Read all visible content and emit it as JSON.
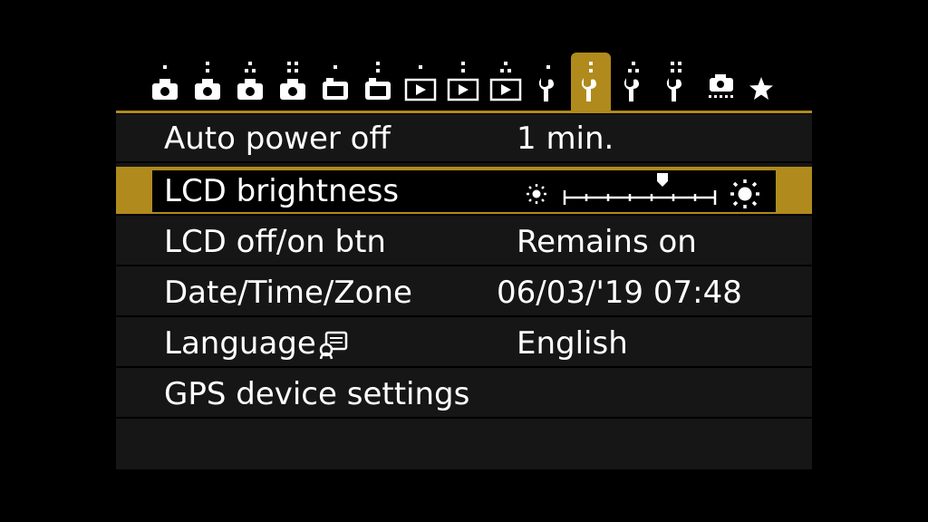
{
  "tabs": [
    {
      "icon": "camera-shooting-1-icon",
      "dots": 1
    },
    {
      "icon": "camera-shooting-2-icon",
      "dots": 2
    },
    {
      "icon": "camera-shooting-3-icon",
      "dots": 3
    },
    {
      "icon": "camera-shooting-4-icon",
      "dots": 4
    },
    {
      "icon": "live-view-1-icon",
      "dots": 1
    },
    {
      "icon": "live-view-2-icon",
      "dots": 2
    },
    {
      "icon": "playback-1-icon",
      "dots": 1
    },
    {
      "icon": "playback-2-icon",
      "dots": 2
    },
    {
      "icon": "playback-3-icon",
      "dots": 3
    },
    {
      "icon": "setup-1-icon",
      "dots": 1
    },
    {
      "icon": "setup-2-icon",
      "dots": 2,
      "active": true
    },
    {
      "icon": "setup-3-icon",
      "dots": 3
    },
    {
      "icon": "setup-4-icon",
      "dots": 4
    },
    {
      "icon": "custom-functions-icon",
      "dots": 0
    },
    {
      "icon": "my-menu-star-icon",
      "dots": 0
    }
  ],
  "colors": {
    "accent": "#b08a1c",
    "row_bg": "#161616",
    "text": "#ffffff"
  },
  "menu": {
    "auto_power_off": {
      "label": "Auto power off",
      "value": "1 min."
    },
    "lcd_brightness": {
      "label": "LCD brightness",
      "level": 5,
      "levels": 7
    },
    "lcd_off_on_btn": {
      "label": "LCD off/on btn",
      "value": "Remains on"
    },
    "date_time_zone": {
      "label": "Date/Time/Zone",
      "value": "06/03/'19 07:48"
    },
    "language": {
      "label": "Language",
      "value": "English",
      "icon": "language-speech-icon"
    },
    "gps_device_settings": {
      "label": "GPS device settings"
    }
  }
}
